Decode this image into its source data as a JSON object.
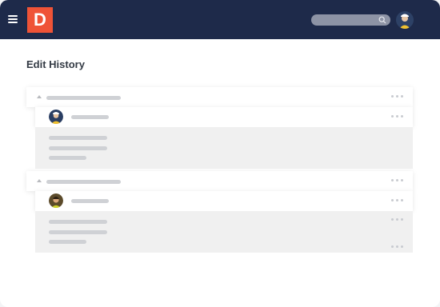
{
  "header": {
    "logo_text": "D",
    "menu_icon": "hamburger-icon",
    "search_icon": "search-icon",
    "brand_color": "#ef5337",
    "nav_color": "#1e2a4a"
  },
  "main": {
    "title": "Edit History"
  }
}
